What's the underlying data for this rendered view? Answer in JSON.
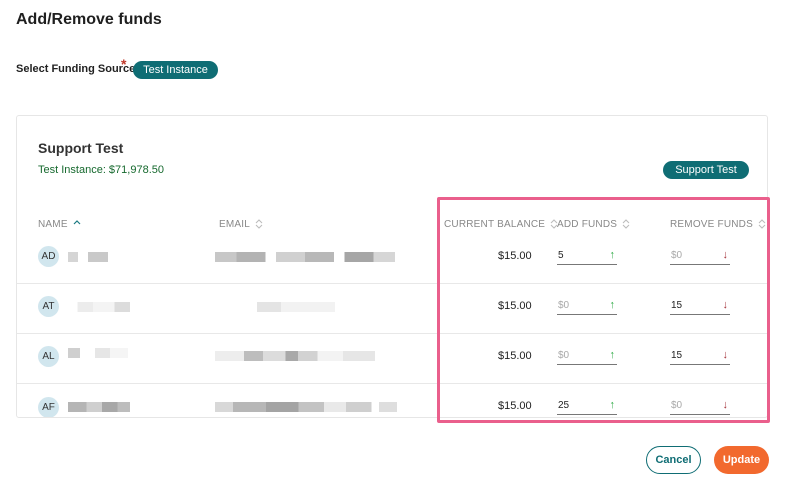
{
  "page": {
    "title": "Add/Remove funds"
  },
  "funding_source": {
    "label": "Select Funding Source",
    "required_mark": "*",
    "selected": "Test Instance"
  },
  "card": {
    "title": "Support Test",
    "subtitle": "Test Instance: $71,978.50",
    "badge": "Support Test"
  },
  "table": {
    "columns": {
      "name": "NAME",
      "email": "EMAIL",
      "current_balance": "CURRENT BALANCE",
      "add_funds": "ADD FUNDS",
      "remove_funds": "REMOVE FUNDS"
    },
    "rows": [
      {
        "initials": "AD",
        "balance": "$15.00",
        "add_value": "5",
        "add_placeholder": "",
        "remove_value": "",
        "remove_placeholder": "$0"
      },
      {
        "initials": "AT",
        "balance": "$15.00",
        "add_value": "",
        "add_placeholder": "$0",
        "remove_value": "15",
        "remove_placeholder": ""
      },
      {
        "initials": "AL",
        "balance": "$15.00",
        "add_value": "",
        "add_placeholder": "$0",
        "remove_value": "15",
        "remove_placeholder": ""
      },
      {
        "initials": "AF",
        "balance": "$15.00",
        "add_value": "25",
        "add_placeholder": "",
        "remove_value": "",
        "remove_placeholder": "$0"
      }
    ]
  },
  "icons": {
    "up": "arrow-up-icon",
    "down": "arrow-down-icon",
    "sort": "sort-icon"
  },
  "colors": {
    "brand": "#0f6d74",
    "update": "#f2692e",
    "highlight": "#ea5f8c",
    "up_arrow": "#2eaa45",
    "down_arrow": "#a6323a"
  },
  "actions": {
    "cancel": "Cancel",
    "update": "Update"
  }
}
